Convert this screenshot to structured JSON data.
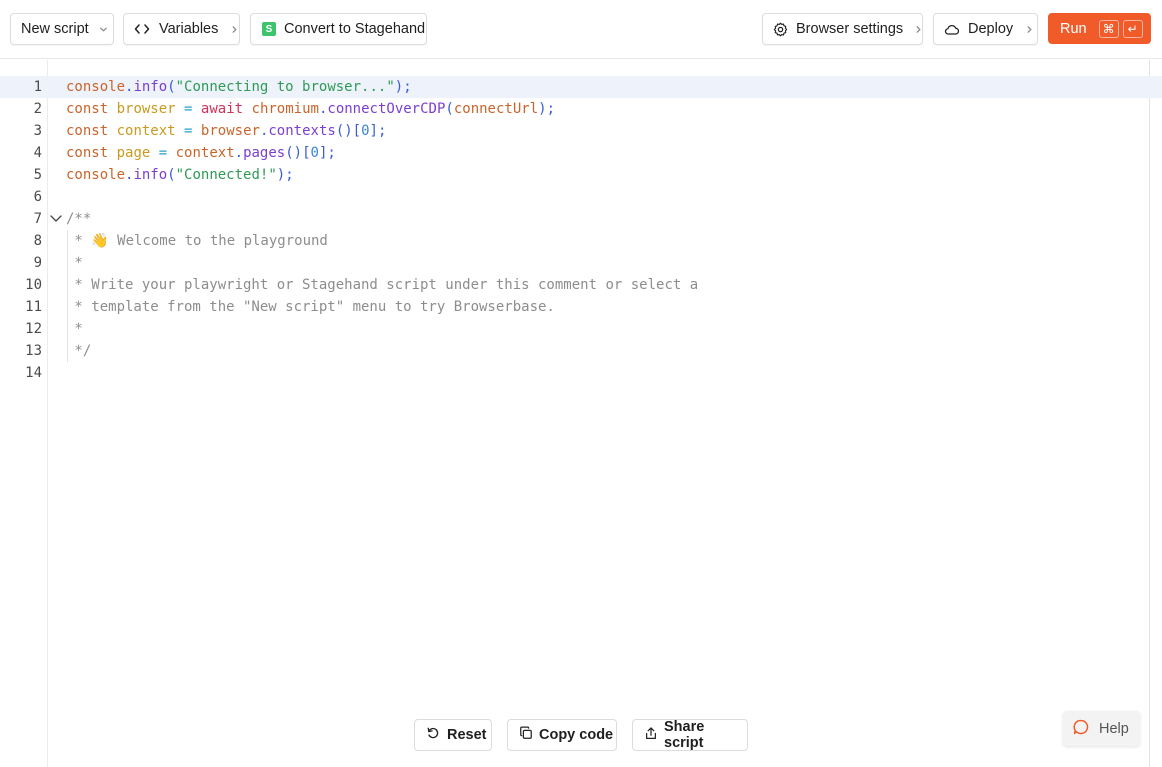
{
  "toolbar": {
    "new_script": "New script",
    "variables": "Variables",
    "convert": "Convert to Stagehand",
    "convert_badge": "S",
    "browser_settings": "Browser settings",
    "deploy": "Deploy",
    "run": "Run",
    "run_key_cmd": "⌘",
    "run_key_enter": "↵"
  },
  "editor": {
    "line_numbers": [
      "1",
      "2",
      "3",
      "4",
      "5",
      "6",
      "7",
      "8",
      "9",
      "10",
      "11",
      "12",
      "13",
      "14"
    ],
    "active_line": 1,
    "lines": {
      "l1": {
        "a": "console",
        "b": ".",
        "c": "info",
        "d": "(",
        "e": "\"Connecting to browser...\"",
        "f": ");"
      },
      "l2": {
        "a": "const",
        "b": "browser",
        "c": "=",
        "d": "await",
        "e": "chromium",
        "f": ".",
        "g": "connectOverCDP",
        "h": "(",
        "i": "connectUrl",
        "j": ");"
      },
      "l3": {
        "a": "const",
        "b": "context",
        "c": "=",
        "d": "browser",
        "e": ".",
        "f": "contexts",
        "g": "()[",
        "h": "0",
        "i": "];"
      },
      "l4": {
        "a": "const",
        "b": "page",
        "c": "=",
        "d": "context",
        "e": ".",
        "f": "pages",
        "g": "()[",
        "h": "0",
        "i": "];"
      },
      "l5": {
        "a": "console",
        "b": ".",
        "c": "info",
        "d": "(",
        "e": "\"Connected!\"",
        "f": ");"
      },
      "l7": "/**",
      "l8": " * 👋 Welcome to the playground",
      "l9": " *",
      "l10": " * Write your playwright or Stagehand script under this comment or select a",
      "l11": " * template from the \"New script\" menu to try Browserbase.",
      "l12": " *",
      "l13": " */"
    }
  },
  "bottom": {
    "reset": "Reset",
    "copy": "Copy code",
    "share": "Share script"
  },
  "help": "Help",
  "colors": {
    "accent": "#f15b2a",
    "convert_badge": "#3ec46d",
    "active_line": "#eef2fb"
  }
}
